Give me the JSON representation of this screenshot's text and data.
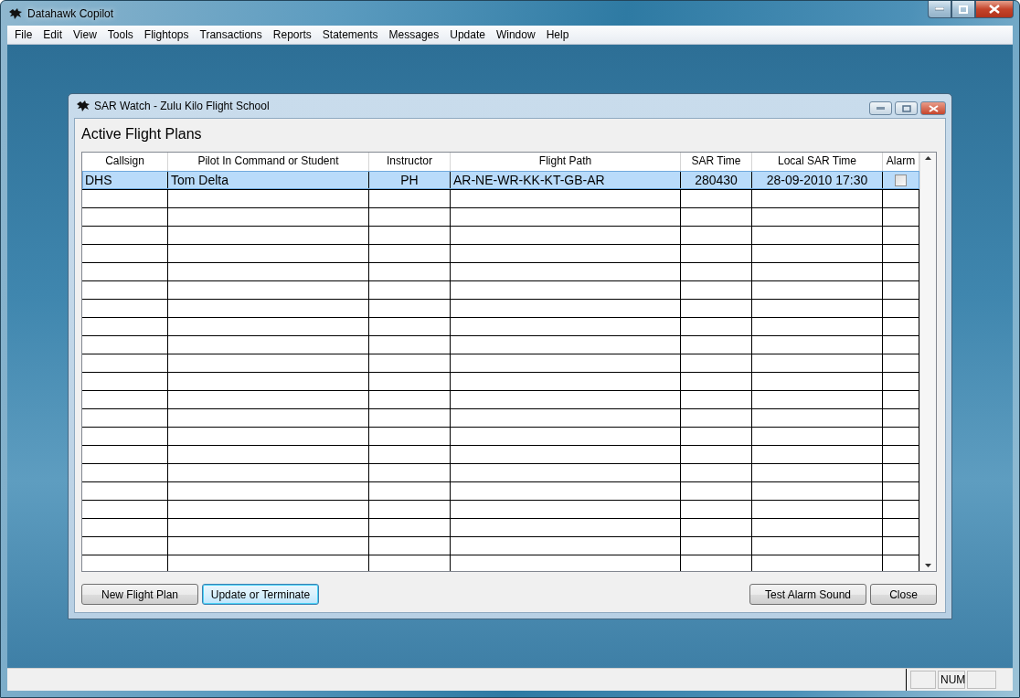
{
  "window": {
    "title": "Datahawk Copilot"
  },
  "menu": [
    "File",
    "Edit",
    "View",
    "Tools",
    "Flightops",
    "Transactions",
    "Reports",
    "Statements",
    "Messages",
    "Update",
    "Window",
    "Help"
  ],
  "dialog": {
    "title": "SAR Watch - Zulu Kilo Flight School",
    "heading": "Active Flight Plans"
  },
  "table": {
    "columns": [
      "Callsign",
      "Pilot In Command or Student",
      "Instructor",
      "Flight Path",
      "SAR Time",
      "Local SAR Time",
      "Alarm"
    ],
    "rows": [
      {
        "selected": true,
        "cells": [
          "DHS",
          "Tom Delta",
          "PH",
          "AR-NE-WR-KK-KT-GB-AR",
          "280430",
          "28-09-2010 17:30"
        ],
        "alarm": false
      }
    ]
  },
  "buttons_left": [
    {
      "label": "New Flight Plan",
      "focused": false
    },
    {
      "label": "Update or Terminate",
      "focused": true
    }
  ],
  "buttons_right": [
    {
      "label": "Test Alarm Sound",
      "focused": false
    },
    {
      "label": "Close",
      "focused": false
    }
  ],
  "status_bar": {
    "indicator": "NUM"
  }
}
